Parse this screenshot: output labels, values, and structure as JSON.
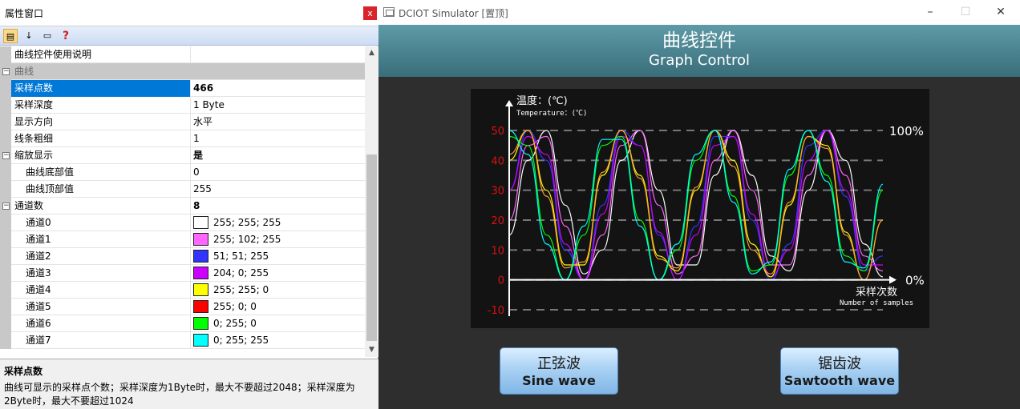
{
  "prop_window": {
    "title": "属性窗口",
    "close_label": "x",
    "rows": [
      {
        "kind": "prop",
        "name": "曲线控件使用说明",
        "value": ""
      },
      {
        "kind": "cat",
        "name": "曲线"
      },
      {
        "kind": "prop",
        "name": "采样点数",
        "value": "466",
        "bold": true,
        "selected": true
      },
      {
        "kind": "prop",
        "name": "采样深度",
        "value": "1 Byte"
      },
      {
        "kind": "prop",
        "name": "显示方向",
        "value": "水平"
      },
      {
        "kind": "prop",
        "name": "线条粗细",
        "value": "1"
      },
      {
        "kind": "group",
        "name": "缩放显示",
        "value": "是",
        "bold": true
      },
      {
        "kind": "sub",
        "name": "曲线底部值",
        "value": "0"
      },
      {
        "kind": "sub",
        "name": "曲线顶部值",
        "value": "255"
      },
      {
        "kind": "group",
        "name": "通道数",
        "value": "8",
        "bold": true
      },
      {
        "kind": "sub",
        "name": "通道0",
        "value": "255; 255; 255",
        "color": "#ffffff"
      },
      {
        "kind": "sub",
        "name": "通道1",
        "value": "255; 102; 255",
        "color": "#ff66ff"
      },
      {
        "kind": "sub",
        "name": "通道2",
        "value": "51; 51; 255",
        "color": "#3333ff"
      },
      {
        "kind": "sub",
        "name": "通道3",
        "value": "204; 0; 255",
        "color": "#cc00ff"
      },
      {
        "kind": "sub",
        "name": "通道4",
        "value": "255; 255; 0",
        "color": "#ffff00"
      },
      {
        "kind": "sub",
        "name": "通道5",
        "value": "255; 0; 0",
        "color": "#ff0000"
      },
      {
        "kind": "sub",
        "name": "通道6",
        "value": "0; 255; 0",
        "color": "#00ff00"
      },
      {
        "kind": "sub",
        "name": "通道7",
        "value": "0; 255; 255",
        "color": "#00ffff"
      }
    ],
    "description": {
      "title": "采样点数",
      "text": "曲线可显示的采样点个数；采样深度为1Byte时，最大不要超过2048；采样深度为2Byte时，最大不要超过1024"
    }
  },
  "sim_window": {
    "title": "DCIOT Simulator [置顶]",
    "header_cn": "曲线控件",
    "header_en": "Graph Control",
    "buttons": {
      "sine_cn": "正弦波",
      "sine_en": "Sine wave",
      "saw_cn": "锯齿波",
      "saw_en": "Sawtooth wave"
    }
  },
  "chart_data": {
    "type": "line",
    "ylabel_cn": "温度：(℃)",
    "ylabel_en": "Temperature：(℃)",
    "xlabel_cn": "采样次数",
    "xlabel_en": "Number of samples",
    "y_ticks": [
      50,
      40,
      30,
      20,
      10,
      0,
      -10
    ],
    "ylim": [
      -10,
      50
    ],
    "right_top_label": "100%",
    "right_bottom_label": "0%",
    "grid": "dashed",
    "series": [
      {
        "color": "#ffffff",
        "values": [
          15,
          40,
          50,
          25,
          2,
          10,
          40,
          50,
          30,
          5,
          5,
          35,
          50,
          35,
          8,
          3,
          30,
          50,
          40,
          12,
          1
        ]
      },
      {
        "color": "#ff66ff",
        "values": [
          20,
          45,
          48,
          18,
          0,
          15,
          45,
          50,
          25,
          2,
          8,
          40,
          50,
          30,
          5,
          5,
          35,
          50,
          35,
          8,
          3
        ]
      },
      {
        "color": "#3333ff",
        "values": [
          30,
          50,
          40,
          10,
          0,
          25,
          50,
          45,
          15,
          0,
          18,
          48,
          48,
          20,
          0,
          12,
          45,
          50,
          28,
          3,
          8
        ]
      },
      {
        "color": "#cc00ff",
        "values": [
          30,
          48,
          42,
          12,
          0,
          22,
          48,
          45,
          16,
          0,
          15,
          45,
          48,
          22,
          1,
          10,
          40,
          50,
          30,
          5,
          5
        ]
      },
      {
        "color": "#ffff00",
        "values": [
          40,
          50,
          30,
          5,
          5,
          35,
          50,
          35,
          8,
          3,
          30,
          50,
          40,
          12,
          1,
          25,
          48,
          45,
          16,
          0,
          20
        ]
      },
      {
        "color": "#ff9933",
        "values": [
          42,
          50,
          28,
          4,
          6,
          36,
          50,
          34,
          7,
          4,
          31,
          50,
          38,
          10,
          2,
          26,
          48,
          44,
          15,
          0,
          20
        ]
      },
      {
        "color": "#00ff00",
        "values": [
          48,
          45,
          15,
          0,
          15,
          45,
          48,
          20,
          0,
          10,
          40,
          50,
          28,
          3,
          5,
          35,
          50,
          35,
          8,
          3,
          30
        ]
      },
      {
        "color": "#00ffff",
        "values": [
          50,
          42,
          12,
          0,
          18,
          47,
          47,
          18,
          0,
          12,
          42,
          50,
          26,
          2,
          6,
          37,
          50,
          33,
          6,
          4,
          32
        ]
      }
    ]
  }
}
